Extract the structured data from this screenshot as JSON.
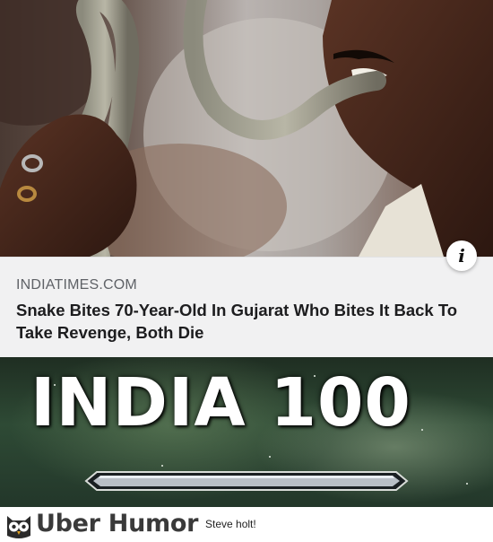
{
  "photo": {
    "info_icon": "info-icon",
    "info_glyph": "i"
  },
  "card": {
    "source": "INDIATIMES.COM",
    "title": "Snake Bites 70-Year-Old In Gujarat Who Bites It Back To Take Revenge, Both Die"
  },
  "meme": {
    "title": "INDIA 100"
  },
  "footer": {
    "brand": "Uber Humor",
    "caption": "Steve holt!",
    "logo_icon": "owl-logo-icon"
  }
}
